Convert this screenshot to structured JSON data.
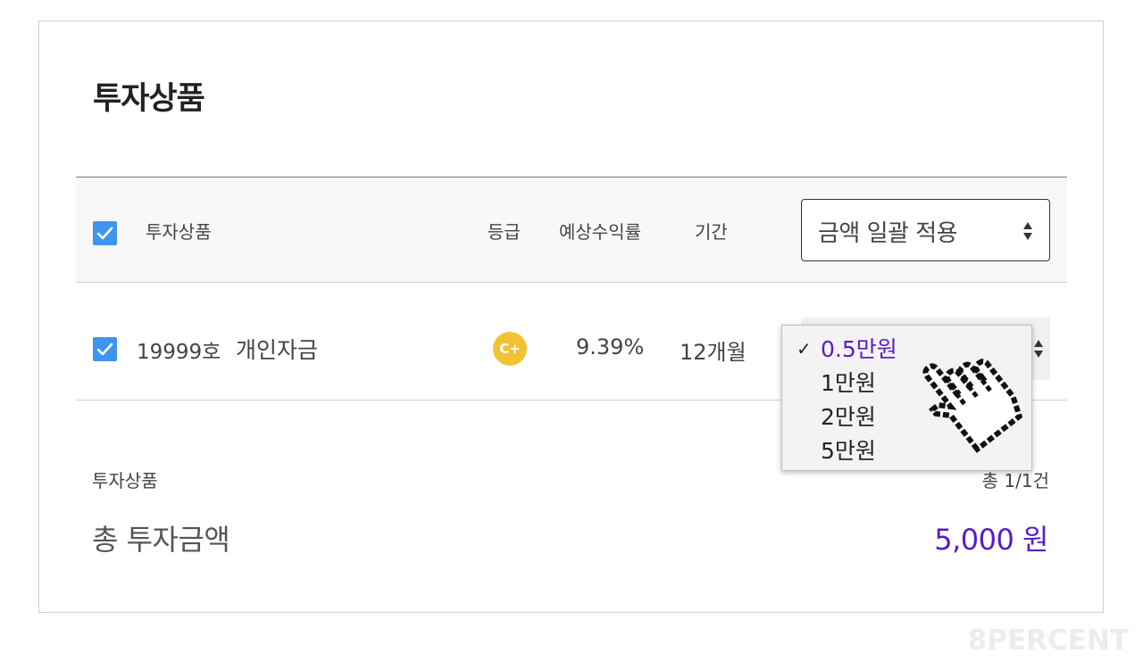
{
  "page": {
    "title": "투자상품"
  },
  "table_header": {
    "product": "투자상품",
    "grade": "등급",
    "expected_return": "예상수익률",
    "period": "기간",
    "bulk_amount_select": "금액 일괄 적용",
    "checkbox_checked": true
  },
  "rows": [
    {
      "checked": true,
      "number": "19999호",
      "name": "개인자금",
      "grade": "C+",
      "rate": "9.39%",
      "period": "12개월"
    }
  ],
  "amount_dropdown": {
    "selected": "0.5만원",
    "check_glyph": "✓",
    "options": [
      "0.5만원",
      "1만원",
      "2만원",
      "5만원"
    ]
  },
  "footer": {
    "label": "투자상품",
    "count": "총 1/1건",
    "total_label": "총 투자금액",
    "total_value": "5,000 원"
  },
  "watermark": "8PERCENT",
  "colors": {
    "accent": "#5a1cc6",
    "checkbox": "#3f94ee",
    "grade_badge": "#f3c232"
  }
}
